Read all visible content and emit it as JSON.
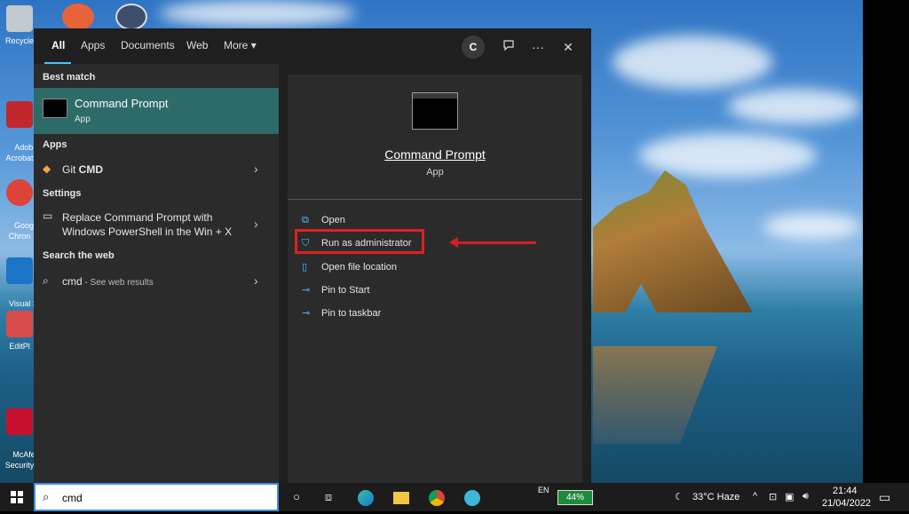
{
  "desktop": {
    "icons": [
      {
        "label": "Recycle",
        "color": "#c0c8d0"
      },
      {
        "label": "Adob\nAcrobat",
        "color": "#c0282d"
      },
      {
        "label": "Goog\nChron",
        "color": "#db4437"
      },
      {
        "label": "Visual St\nCode",
        "color": "#1b74c5"
      },
      {
        "label": "EditPl",
        "color": "#d84b4b"
      },
      {
        "label": "McAfe\nSecurity",
        "color": "#c8102e"
      }
    ]
  },
  "start_menu": {
    "tabs": [
      "All",
      "Apps",
      "Documents",
      "Web",
      "More"
    ],
    "more_chevron": "▾",
    "user_initial": "C",
    "feedback_icon": "feedback-icon",
    "options_label": "···",
    "close_label": "✕",
    "sections": {
      "best_match": "Best match",
      "apps": "Apps",
      "settings": "Settings",
      "search_web": "Search the web"
    },
    "best_match": {
      "title": "Command Prompt",
      "subtitle": "App"
    },
    "apps_item": {
      "prefix": "Git ",
      "bold": "CMD"
    },
    "settings_item": {
      "line1": "Replace Command Prompt with",
      "line2": "Windows PowerShell in the Win + X"
    },
    "web_item": {
      "query": "cmd",
      "suffix": " - See web results"
    },
    "detail": {
      "name": "Command Prompt",
      "kind": "App",
      "actions": [
        "Open",
        "Run as administrator",
        "Open file location",
        "Pin to Start",
        "Pin to taskbar"
      ]
    }
  },
  "taskbar": {
    "search_value": "cmd",
    "language": "EN",
    "battery": "44%",
    "weather": "33°C  Haze",
    "time": "21:44",
    "date": "21/04/2022"
  },
  "colors": {
    "accent": "#4cc2ff",
    "selected": "#2c6b68",
    "highlight_border": "#e02020"
  }
}
